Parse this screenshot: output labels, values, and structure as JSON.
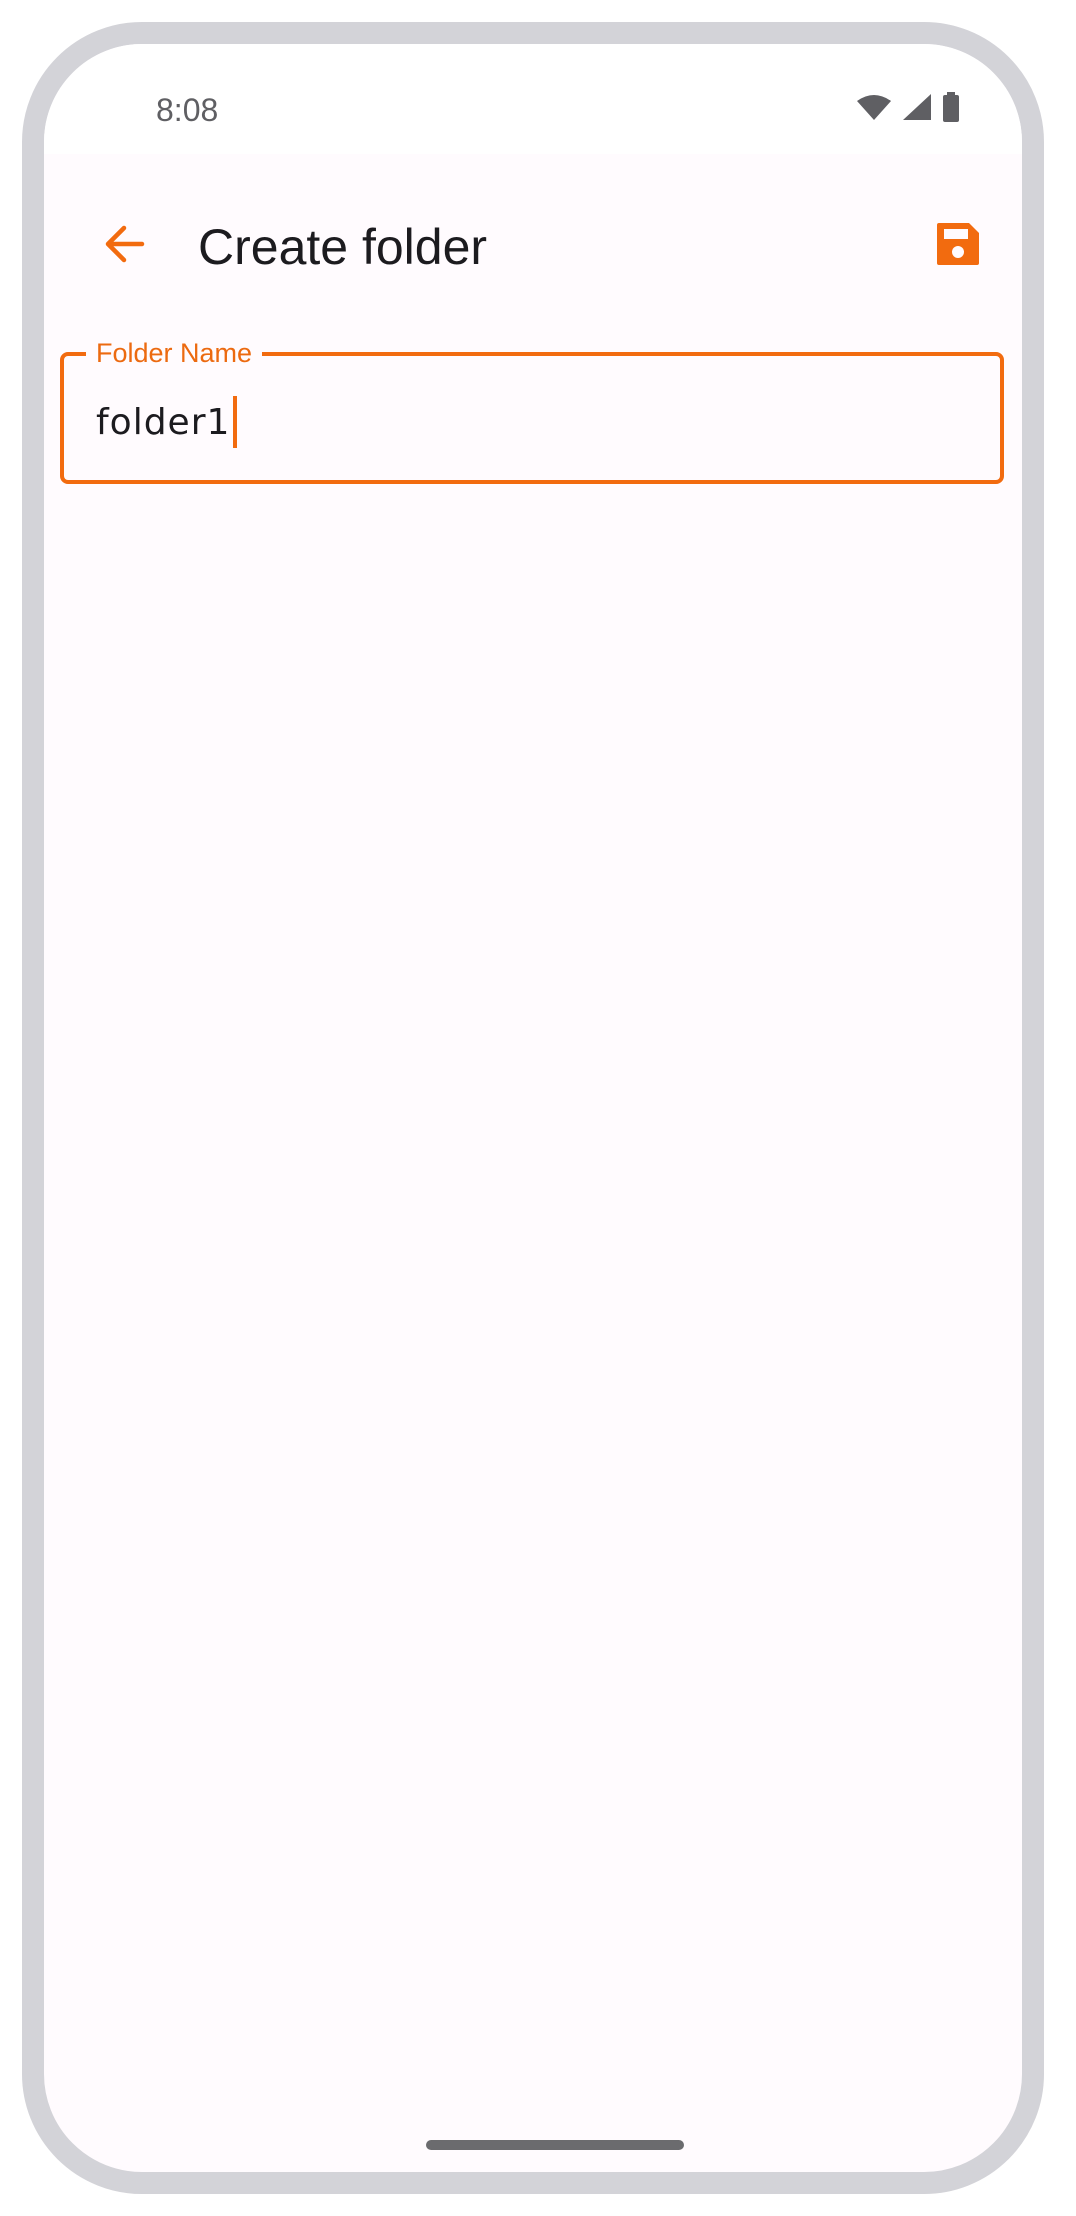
{
  "status_bar": {
    "time": "8:08",
    "icons": [
      "wifi-icon",
      "signal-icon",
      "battery-icon"
    ]
  },
  "app_bar": {
    "back_icon": "arrow-left-icon",
    "title": "Create folder",
    "save_icon": "floppy-disk-icon"
  },
  "form": {
    "folder_name": {
      "label": "Folder Name",
      "value": "folder1"
    }
  },
  "colors": {
    "accent": "#f26b0f",
    "background": "#fffbfe",
    "text": "#1c1b1f",
    "frame": "#d3d3d8"
  }
}
